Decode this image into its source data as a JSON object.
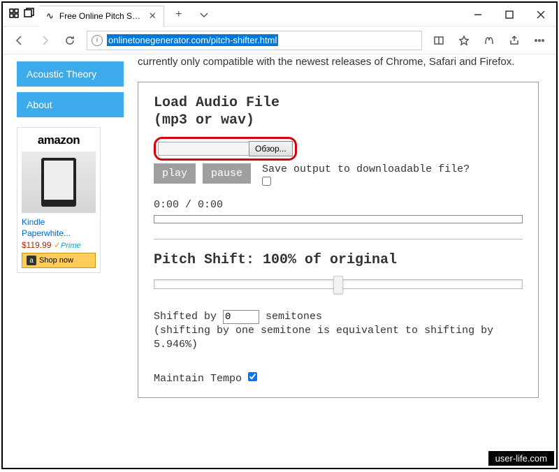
{
  "window": {
    "tab_title": "Free Online Pitch Shifte",
    "address": "onlinetonegenerator.com/pitch-shifter.html"
  },
  "sidebar": {
    "items": [
      "Acoustic Theory",
      "About"
    ]
  },
  "ad": {
    "logo": "amazon",
    "product": "Kindle Paperwhite...",
    "price": "$119.99",
    "prime": "Prime",
    "shop": "Shop now"
  },
  "intro": "currently only compatible with the newest releases of Chrome, Safari and Firefox.",
  "panel": {
    "heading": "Load Audio File",
    "subheading": "(mp3 or wav)",
    "browse": "Обзор...",
    "play": "play",
    "pause": "pause",
    "save_label": "Save output to downloadable file?",
    "time": "0:00 / 0:00",
    "pitch_title": "Pitch Shift: 100% of original",
    "shift_label_before": "Shifted by",
    "shift_value": "0",
    "shift_label_after": "semitones",
    "shift_note": "(shifting by one semitone is equivalent to shifting by 5.946%)",
    "tempo_label": "Maintain Tempo"
  },
  "watermark": "user-life.com"
}
